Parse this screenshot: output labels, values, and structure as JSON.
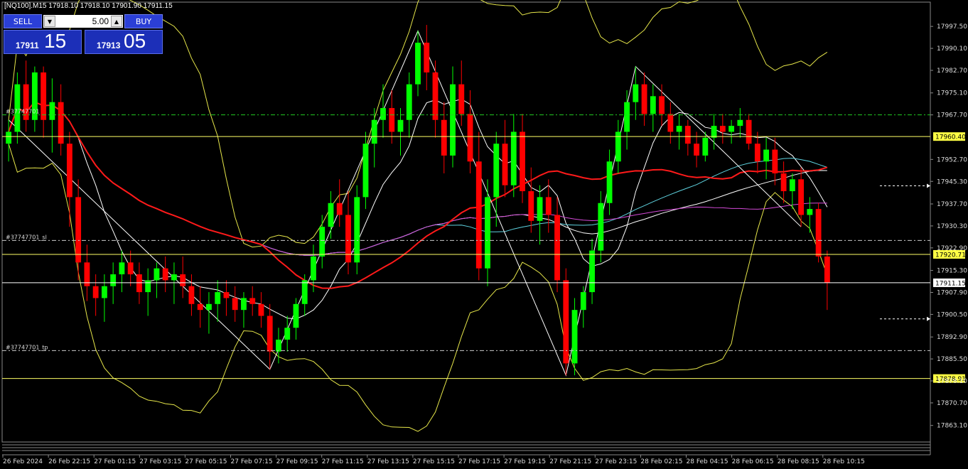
{
  "header": {
    "title": "[NQ100].M15  17918.10 17918.10 17901.90 17911.15"
  },
  "trade_panel": {
    "sell_label": "SELL",
    "buy_label": "BUY",
    "lot": "5.00",
    "sell_price_small": "17911",
    "sell_price_big": "15",
    "buy_price_small": "17913",
    "buy_price_big": "05"
  },
  "price_axis": {
    "ticks": [
      "17997.50",
      "17990.10",
      "17982.70",
      "17975.10",
      "17967.70",
      "17960.40",
      "17952.70",
      "17945.30",
      "17937.70",
      "17930.30",
      "17922.90",
      "17920.71",
      "17915.30",
      "17911.15",
      "17907.90",
      "17900.50",
      "17892.90",
      "17885.50",
      "17878.91",
      "17878.10",
      "17870.70",
      "17863.10"
    ],
    "hl_upper": "17960.40",
    "hl_mid": "17920.71",
    "hl_current": "17911.15",
    "hl_lower": "17878.91"
  },
  "time_axis": {
    "labels": [
      "26 Feb 2024",
      "26 Feb 22:15",
      "27 Feb 01:15",
      "27 Feb 03:15",
      "27 Feb 05:15",
      "27 Feb 07:15",
      "27 Feb 09:15",
      "27 Feb 11:15",
      "27 Feb 13:15",
      "27 Feb 15:15",
      "27 Feb 17:15",
      "27 Feb 19:15",
      "27 Feb 21:15",
      "27 Feb 23:15",
      "28 Feb 02:15",
      "28 Feb 04:15",
      "28 Feb 06:15",
      "28 Feb 08:15",
      "28 Feb 10:15"
    ]
  },
  "order_lines": {
    "entry": "#37747701",
    "sl": "#37747701_sl",
    "tp": "#37747701_tp"
  },
  "colors": {
    "bull": "#00ff00",
    "bear": "#ff0000",
    "ma_red": "#ff1a1a",
    "ma_white": "#ffffff",
    "ma_cyan": "#5fd3e0",
    "ma_magenta": "#d44ad8",
    "bollinger": "#e6e64a",
    "hline": "#ffff66"
  },
  "chart_data": {
    "type": "candlestick",
    "symbol": "[NQ100]",
    "timeframe": "M15",
    "ylim": [
      17858,
      18004
    ],
    "ohlc_last": {
      "open": 17918.1,
      "high": 17918.1,
      "low": 17901.9,
      "close": 17911.15
    },
    "candles": [
      [
        17958,
        17966,
        17952,
        17962
      ],
      [
        17962,
        17982,
        17958,
        17978
      ],
      [
        17978,
        17986,
        17962,
        17966
      ],
      [
        17966,
        17984,
        17962,
        17982
      ],
      [
        17982,
        17984,
        17960,
        17966
      ],
      [
        17966,
        17980,
        17955,
        17972
      ],
      [
        17972,
        17978,
        17954,
        17958
      ],
      [
        17958,
        17962,
        17930,
        17940
      ],
      [
        17940,
        17946,
        17912,
        17918
      ],
      [
        17918,
        17924,
        17905,
        17910
      ],
      [
        17910,
        17914,
        17900,
        17906
      ],
      [
        17906,
        17914,
        17898,
        17910
      ],
      [
        17910,
        17918,
        17904,
        17914
      ],
      [
        17914,
        17922,
        17908,
        17918
      ],
      [
        17918,
        17922,
        17910,
        17914
      ],
      [
        17914,
        17918,
        17904,
        17908
      ],
      [
        17908,
        17916,
        17900,
        17912
      ],
      [
        17912,
        17918,
        17906,
        17916
      ],
      [
        17916,
        17920,
        17908,
        17912
      ],
      [
        17912,
        17918,
        17904,
        17914
      ],
      [
        17914,
        17920,
        17906,
        17910
      ],
      [
        17910,
        17914,
        17900,
        17904
      ],
      [
        17904,
        17910,
        17896,
        17902
      ],
      [
        17902,
        17908,
        17894,
        17904
      ],
      [
        17904,
        17912,
        17898,
        17908
      ],
      [
        17908,
        17912,
        17900,
        17906
      ],
      [
        17906,
        17910,
        17898,
        17902
      ],
      [
        17902,
        17908,
        17896,
        17906
      ],
      [
        17906,
        17910,
        17900,
        17904
      ],
      [
        17904,
        17908,
        17896,
        17900
      ],
      [
        17900,
        17904,
        17882,
        17888
      ],
      [
        17888,
        17896,
        17884,
        17892
      ],
      [
        17892,
        17900,
        17888,
        17896
      ],
      [
        17896,
        17906,
        17892,
        17904
      ],
      [
        17904,
        17914,
        17900,
        17912
      ],
      [
        17912,
        17924,
        17908,
        17920
      ],
      [
        17920,
        17934,
        17916,
        17930
      ],
      [
        17930,
        17942,
        17926,
        17938
      ],
      [
        17938,
        17946,
        17930,
        17934
      ],
      [
        17934,
        17942,
        17914,
        17918
      ],
      [
        17918,
        17944,
        17914,
        17940
      ],
      [
        17940,
        17962,
        17936,
        17958
      ],
      [
        17958,
        17970,
        17950,
        17966
      ],
      [
        17966,
        17978,
        17960,
        17970
      ],
      [
        17970,
        17976,
        17958,
        17962
      ],
      [
        17962,
        17970,
        17954,
        17966
      ],
      [
        17966,
        17982,
        17960,
        17978
      ],
      [
        17978,
        17996,
        17974,
        17992
      ],
      [
        17992,
        17998,
        17976,
        17982
      ],
      [
        17982,
        17986,
        17960,
        17966
      ],
      [
        17966,
        17972,
        17948,
        17954
      ],
      [
        17954,
        17984,
        17950,
        17978
      ],
      [
        17978,
        17986,
        17964,
        17968
      ],
      [
        17968,
        17976,
        17948,
        17952
      ],
      [
        17952,
        17962,
        17912,
        17916
      ],
      [
        17916,
        17946,
        17910,
        17940
      ],
      [
        17940,
        17962,
        17930,
        17958
      ],
      [
        17958,
        17966,
        17940,
        17944
      ],
      [
        17944,
        17968,
        17940,
        17962
      ],
      [
        17962,
        17968,
        17938,
        17942
      ],
      [
        17942,
        17950,
        17928,
        17932
      ],
      [
        17932,
        17944,
        17924,
        17940
      ],
      [
        17940,
        17946,
        17928,
        17934
      ],
      [
        17934,
        17940,
        17908,
        17912
      ],
      [
        17912,
        17916,
        17880,
        17884
      ],
      [
        17884,
        17906,
        17880,
        17902
      ],
      [
        17902,
        17910,
        17896,
        17908
      ],
      [
        17908,
        17926,
        17904,
        17922
      ],
      [
        17922,
        17942,
        17918,
        17938
      ],
      [
        17938,
        17956,
        17934,
        17952
      ],
      [
        17952,
        17966,
        17948,
        17962
      ],
      [
        17962,
        17976,
        17956,
        17972
      ],
      [
        17972,
        17984,
        17966,
        17978
      ],
      [
        17978,
        17982,
        17964,
        17968
      ],
      [
        17968,
        17978,
        17962,
        17974
      ],
      [
        17974,
        17978,
        17964,
        17968
      ],
      [
        17968,
        17972,
        17958,
        17962
      ],
      [
        17962,
        17968,
        17956,
        17964
      ],
      [
        17964,
        17966,
        17954,
        17958
      ],
      [
        17958,
        17962,
        17950,
        17954
      ],
      [
        17954,
        17962,
        17952,
        17960
      ],
      [
        17960,
        17968,
        17956,
        17964
      ],
      [
        17964,
        17968,
        17958,
        17962
      ],
      [
        17962,
        17966,
        17958,
        17964
      ],
      [
        17964,
        17970,
        17960,
        17966
      ],
      [
        17966,
        17968,
        17956,
        17958
      ],
      [
        17958,
        17962,
        17948,
        17952
      ],
      [
        17952,
        17960,
        17946,
        17956
      ],
      [
        17956,
        17960,
        17944,
        17948
      ],
      [
        17948,
        17952,
        17938,
        17942
      ],
      [
        17942,
        17948,
        17936,
        17946
      ],
      [
        17946,
        17950,
        17930,
        17934
      ],
      [
        17934,
        17940,
        17928,
        17936
      ],
      [
        17936,
        17938,
        17918,
        17920
      ],
      [
        17920,
        17922,
        17902,
        17911.15
      ]
    ]
  }
}
